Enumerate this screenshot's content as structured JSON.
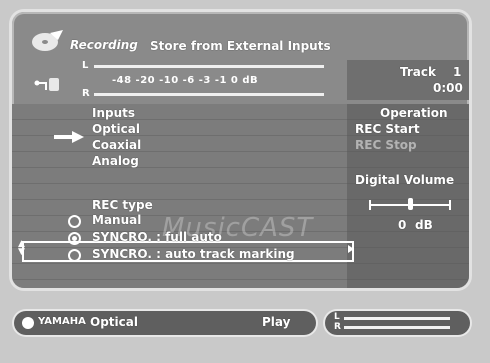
{
  "header": {
    "title": "Recording",
    "subtitle": "Store from External Inputs"
  },
  "meter": {
    "left_label": "L",
    "right_label": "R",
    "scale": "-48 -20 -10 -6 -3 -1 0 dB"
  },
  "track": {
    "label": "Track",
    "number": "1",
    "time": "0:00"
  },
  "inputs": {
    "heading": "Inputs",
    "items": [
      "Optical",
      "Coaxial",
      "Analog"
    ],
    "selected_index": 0
  },
  "operation": {
    "heading": "Operation",
    "rec_start": "REC Start",
    "rec_stop": "REC Stop"
  },
  "digital_volume": {
    "label": "Digital Volume",
    "value": "0",
    "unit": "dB"
  },
  "rec_type": {
    "heading": "REC type",
    "options": [
      {
        "label": "Manual",
        "selected": false
      },
      {
        "label": "SYNCRO. : full auto",
        "selected": true
      },
      {
        "label": "SYNCRO. : auto track marking",
        "selected": false
      }
    ]
  },
  "watermark": "MusicCAST",
  "status_bar": {
    "brand": "YAMAHA",
    "source": "Optical",
    "state": "Play",
    "level_l": "L",
    "level_r": "R"
  },
  "icons": {
    "logo": "recording-disc-icon",
    "connector": "input-connector-icon",
    "pointer": "selection-arrow-icon"
  }
}
